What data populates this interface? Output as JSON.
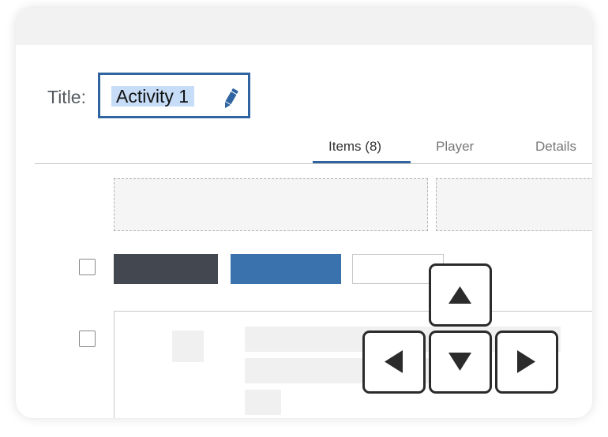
{
  "header": {
    "title_label": "Title:",
    "title_value": "Activity 1",
    "edit_icon": "pencil-icon"
  },
  "tabs": [
    {
      "label": "Items (8)",
      "active": true
    },
    {
      "label": "Player",
      "active": false
    },
    {
      "label": "Details",
      "active": false
    }
  ],
  "keyboard_overlay": {
    "keys": [
      "arrow-up",
      "arrow-left",
      "arrow-down",
      "arrow-right"
    ]
  },
  "colors": {
    "accent": "#2f64a0",
    "selection": "#c6dcf7",
    "dark_button": "#434850",
    "blue_button": "#3a72ad"
  }
}
